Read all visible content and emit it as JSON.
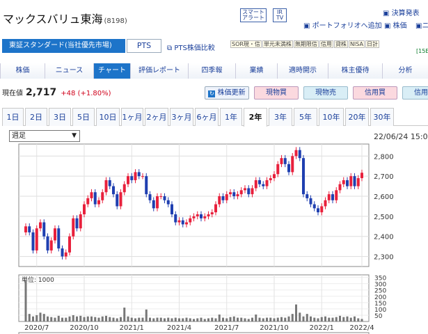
{
  "header": {
    "company_name": "マックスバリュ東海",
    "code": "(8198)",
    "badge_smart_alert_1": "スマート",
    "badge_smart_alert_2": "アラート",
    "badge_ir_1": "IR",
    "badge_ir_2": "TV",
    "link_settlement": "決算発表",
    "link_portfolio": "ポートフォリオへ追加",
    "link_stock": "株価",
    "link_more": "ニ"
  },
  "market_tabs": {
    "market_label": "東証スタンダード(当社優先市場)",
    "pts_label": "PTS",
    "pts_compare": "PTS株価比較",
    "tags": [
      "SOR現・信",
      "単元未満株",
      "無期限信",
      "信用",
      "貸株",
      "NISA",
      "日計"
    ],
    "sub_tag": "[15E"
  },
  "nav": {
    "items": [
      "株価",
      "ニュース",
      "チャート",
      "評価レポート",
      "四季報",
      "業績",
      "適時開示",
      "株主優待",
      "分析"
    ],
    "active": "チャート"
  },
  "quote": {
    "label": "現在値",
    "price": "2,717",
    "change": "+48 (+1.80%)",
    "refresh": "株価更新",
    "buy_spot": "現物買",
    "sell_spot": "現物売",
    "buy_margin": "信用買",
    "sell_margin": "信用売"
  },
  "periods": {
    "items": [
      "1日",
      "2日",
      "3日",
      "5日",
      "10日",
      "1ヶ月",
      "2ヶ月",
      "3ヶ月",
      "6ヶ月",
      "1年",
      "2年",
      "3年",
      "5年",
      "10年",
      "20年",
      "30年"
    ],
    "selected": "2年"
  },
  "chart_controls": {
    "interval": "週足",
    "date": "22/06/24 15:0"
  },
  "chart_data": {
    "type": "candlestick",
    "y_ticks": [
      "2,800",
      "2,700",
      "2,600",
      "2,500",
      "2,400",
      "2,300"
    ],
    "ylim": [
      2250,
      2860
    ],
    "x_ticks": [
      "2020/7",
      "2020/10",
      "2021/1",
      "2021/4",
      "2021/7",
      "2021/10",
      "2022/1",
      "2022/4"
    ],
    "volume_unit": "単位: 1000",
    "volume_ticks": [
      "350",
      "300",
      "250",
      "200",
      "150",
      "100",
      "50"
    ],
    "volume_ylim": [
      0,
      370
    ],
    "closes": [
      2450,
      2420,
      2330,
      2440,
      2470,
      2400,
      2330,
      2380,
      2440,
      2340,
      2300,
      2320,
      2400,
      2490,
      2440,
      2510,
      2560,
      2590,
      2620,
      2560,
      2580,
      2620,
      2680,
      2650,
      2610,
      2550,
      2620,
      2660,
      2700,
      2680,
      2720,
      2700,
      2700,
      2610,
      2580,
      2540,
      2600,
      2600,
      2580,
      2560,
      2510,
      2470,
      2480,
      2460,
      2470,
      2490,
      2500,
      2510,
      2490,
      2500,
      2510,
      2520,
      2560,
      2600,
      2580,
      2610,
      2620,
      2600,
      2610,
      2630,
      2640,
      2610,
      2640,
      2680,
      2660,
      2650,
      2680,
      2690,
      2710,
      2760,
      2790,
      2760,
      2720,
      2800,
      2830,
      2790,
      2610,
      2590,
      2560,
      2540,
      2520,
      2550,
      2580,
      2610,
      2580,
      2630,
      2660,
      2680,
      2650,
      2700,
      2650,
      2690,
      2717
    ],
    "volumes": [
      320,
      60,
      40,
      50,
      70,
      60,
      40,
      35,
      30,
      45,
      30,
      30,
      40,
      50,
      40,
      45,
      35,
      40,
      40,
      35,
      30,
      40,
      45,
      35,
      30,
      25,
      35,
      110,
      40,
      30,
      25,
      30,
      30,
      95,
      30,
      25,
      30,
      30,
      25,
      30,
      25,
      30,
      25,
      25,
      30,
      25,
      20,
      25,
      30,
      20,
      25,
      30,
      25,
      55,
      30,
      25,
      35,
      40,
      30,
      30,
      25,
      20,
      30,
      55,
      30,
      25,
      30,
      30,
      25,
      30,
      35,
      30,
      40,
      60,
      135,
      70,
      40,
      60,
      40,
      30,
      25,
      35,
      40,
      30,
      30,
      35,
      45,
      35,
      40,
      30,
      40,
      25,
      20
    ]
  }
}
